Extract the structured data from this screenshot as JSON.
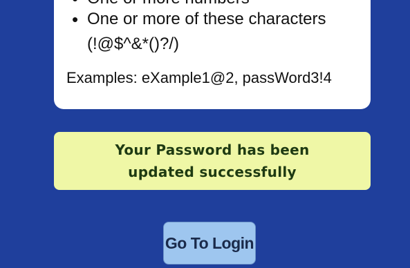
{
  "rules": {
    "items": [
      "One or more numbers",
      "One or more of these characters (!@$^&*()?/)"
    ],
    "examples": "Examples: eXample1@2, passWord3!4"
  },
  "success": {
    "message": "Your Password has been updated successfully"
  },
  "actions": {
    "login_label": "Go To Login"
  },
  "colors": {
    "background": "#1f3f9c",
    "success_bg": "#eff7a6",
    "button_bg": "#9ec6ef"
  }
}
